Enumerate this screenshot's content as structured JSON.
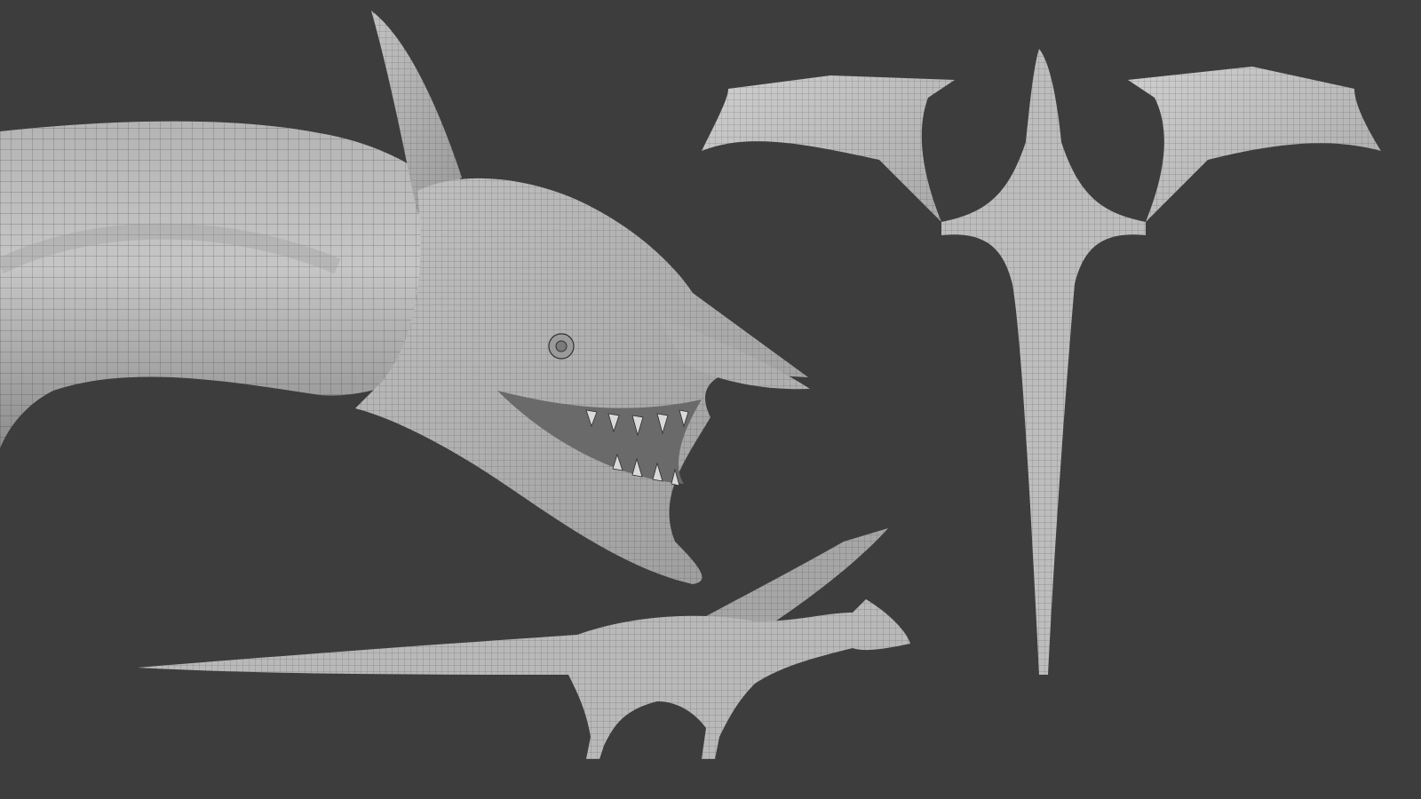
{
  "scene": {
    "subject": "wireframe-dragon-model",
    "views": [
      "head-closeup",
      "top-view",
      "side-view"
    ]
  },
  "colors": {
    "background": "#3d3d3d",
    "mesh_light": "#c4c4c4",
    "mesh_mid": "#a9a9a9",
    "mesh_dark": "#8a8a8a",
    "wire": "#2f2f2f",
    "teeth": "#d9d9d9"
  }
}
